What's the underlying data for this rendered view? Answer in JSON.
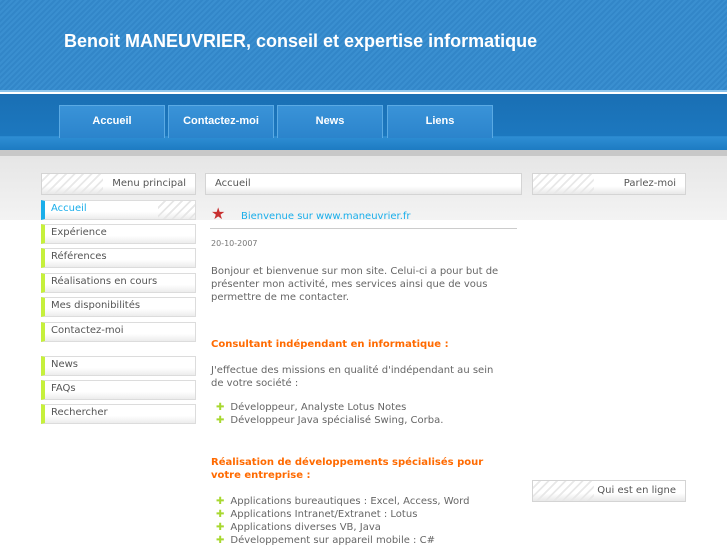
{
  "header": {
    "title": "Benoit MANEUVRIER, conseil et expertise informatique"
  },
  "nav": [
    "Accueil",
    "Contactez-moi",
    "News",
    "Liens"
  ],
  "sidebar": {
    "title": "Menu principal",
    "items": [
      "Accueil",
      "Expérience",
      "Références",
      "Réalisations en cours",
      "Mes disponibilités",
      "Contactez-moi"
    ],
    "items2": [
      "News",
      "FAQs",
      "Rechercher"
    ]
  },
  "main": {
    "title": "Accueil",
    "article_link": "Bienvenue sur www.maneuvrier.fr",
    "date": "20-10-2007",
    "intro": "Bonjour et  bienvenue sur mon site. Celui-ci a pour but de présenter mon activité, mes services ainsi que de vous permettre de me contacter.",
    "h1": "Consultant indépendant en informatique :",
    "p1": "J'effectue des missions en qualité d'indépendant au sein de votre société :",
    "list1": [
      "Développeur, Analyste Lotus Notes",
      "Développeur Java spécialisé Swing, Corba."
    ],
    "h2": "Réalisation de développements spécialisés pour votre entreprise :",
    "list2": [
      "Applications bureautiques : Excel, Access, Word",
      "Applications Intranet/Extranet : Lotus",
      "Applications diverses VB, Java",
      "Développement sur appareil mobile : C#"
    ]
  },
  "right": {
    "title1": "Parlez-moi",
    "title2": "Qui est en ligne"
  }
}
